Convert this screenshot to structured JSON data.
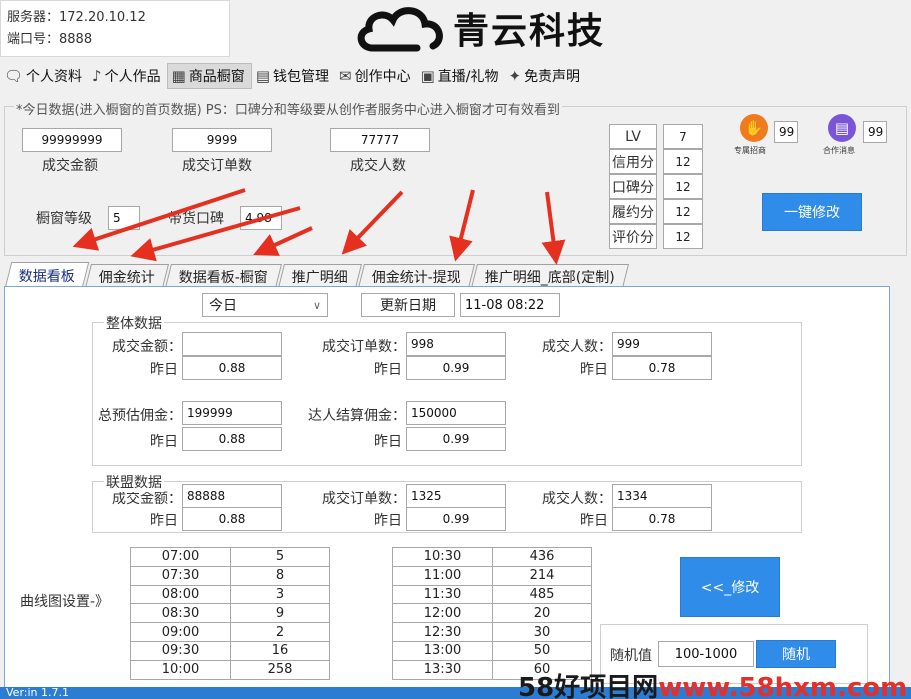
{
  "server": {
    "label": "服务器：",
    "value": "172.20.10.12",
    "port_label": "端口号：",
    "port_value": "8888"
  },
  "logo": {
    "text": "青云科技"
  },
  "menu": [
    {
      "icon": "🗨",
      "label": "个人资料"
    },
    {
      "icon": "♪",
      "label": "个人作品"
    },
    {
      "icon": "▦",
      "label": "商品橱窗"
    },
    {
      "icon": "▤",
      "label": "钱包管理"
    },
    {
      "icon": "✉",
      "label": "创作中心"
    },
    {
      "icon": "▣",
      "label": "直播/礼物"
    },
    {
      "icon": "✦",
      "label": "免责声明"
    }
  ],
  "today": {
    "caption": "*今日数据(进入橱窗的首页数据) PS：口碑分和等级要从创作者服务中心进入橱窗才可有效看到",
    "stats": [
      {
        "value": "99999999",
        "label": "成交金额"
      },
      {
        "value": "9999",
        "label": "成交订单数"
      },
      {
        "value": "77777",
        "label": "成交人数"
      }
    ],
    "level_label": "橱窗等级",
    "level_value": "5",
    "koubei_label": "带货口碑",
    "koubei_value": "4.98",
    "lv_table": [
      {
        "key": "LV",
        "value": "7"
      },
      {
        "key": "信用分",
        "value": "12"
      },
      {
        "key": "口碑分",
        "value": "12"
      },
      {
        "key": "履约分",
        "value": "12"
      },
      {
        "key": "评价分",
        "value": "12"
      }
    ],
    "badge1": {
      "label": "专属招商",
      "value": "99"
    },
    "badge2": {
      "label": "合作消息",
      "value": "99"
    },
    "modify_button": "一键修改"
  },
  "tabs": [
    "数据看板",
    "佣金统计",
    "数据看板-橱窗",
    "推广明细",
    "佣金统计-提现",
    "推广明细_底部(定制)"
  ],
  "board": {
    "period": "今日",
    "update_button": "更新日期",
    "update_value": "11-08 08:22",
    "overall": {
      "title": "整体数据",
      "amount_label": "成交金额：",
      "amount_value": "",
      "orders_label": "成交订单数：",
      "orders_value": "998",
      "people_label": "成交人数：",
      "people_value": "999",
      "yesterday_label": "昨日",
      "amount_yday": "0.88",
      "orders_yday": "0.99",
      "people_yday": "0.78",
      "est_label": "总预估佣金：",
      "est_value": "199999",
      "settle_label": "达人结算佣金：",
      "settle_value": "150000",
      "est_yday": "0.88",
      "settle_yday": "0.99"
    },
    "alliance": {
      "title": "联盟数据",
      "amount_label": "成交金额：",
      "amount_value": "88888",
      "orders_label": "成交订单数：",
      "orders_value": "1325",
      "people_label": "成交人数：",
      "people_value": "1334",
      "yesterday_label": "昨日",
      "amount_yday": "0.88",
      "orders_yday": "0.99",
      "people_yday": "0.78"
    },
    "curve_label": "曲线图设置-》",
    "table_left": [
      {
        "t": "07:00",
        "v": "5"
      },
      {
        "t": "07:30",
        "v": "8"
      },
      {
        "t": "08:00",
        "v": "3"
      },
      {
        "t": "08:30",
        "v": "9"
      },
      {
        "t": "09:00",
        "v": "2"
      },
      {
        "t": "09:30",
        "v": "16"
      },
      {
        "t": "10:00",
        "v": "258"
      }
    ],
    "table_right": [
      {
        "t": "10:30",
        "v": "436"
      },
      {
        "t": "11:00",
        "v": "214"
      },
      {
        "t": "11:30",
        "v": "485"
      },
      {
        "t": "12:00",
        "v": "20"
      },
      {
        "t": "12:30",
        "v": "30"
      },
      {
        "t": "13:00",
        "v": "50"
      },
      {
        "t": "13:30",
        "v": "60"
      }
    ],
    "modify_button": "<<_修改",
    "random_label": "随机值",
    "random_value": "100-1000",
    "random_button": "随机"
  },
  "status": {
    "text": "Ver:in 1.7.1"
  },
  "watermark": {
    "prefix": "58好项目网",
    "suffix": "www.58hxm.com"
  },
  "colors": {
    "accent": "#2f8ce8",
    "arrow": "#e5301f",
    "badge1": "#f07b1e",
    "badge2": "#7a55d8"
  }
}
